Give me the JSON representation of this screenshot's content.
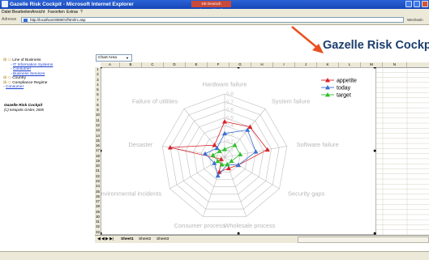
{
  "window": {
    "title": "Gazelle Risk Cockpit - Microsoft Internet Explorer",
    "language_indicator": "DE Deutsch (Deutschland)"
  },
  "menu": [
    "Datei",
    "Bearbeiten",
    "Ansicht",
    "Favoriten",
    "Extras",
    "?"
  ],
  "address": {
    "label": "Adresse",
    "url": "http://localhost:8080/rcfhtml/rc.asp",
    "go_label": "Wechseln"
  },
  "banner": {
    "title": "Gazelle Risk Cockpit"
  },
  "tree": [
    {
      "label": "Line of Business",
      "level": 0,
      "link": false,
      "icon": "folder-open-icon"
    },
    {
      "label": "IT Information Systems",
      "level": 1,
      "link": true,
      "icon": "page-icon"
    },
    {
      "label": "Consumer",
      "level": 1,
      "link": true,
      "icon": "page-icon"
    },
    {
      "label": "Business Services",
      "level": 1,
      "link": true,
      "icon": "page-icon"
    },
    {
      "label": "Country",
      "level": 0,
      "link": false,
      "icon": "folder-icon"
    },
    {
      "label": "Compliance Regime",
      "level": 0,
      "link": false,
      "icon": "folder-icon"
    },
    {
      "label": "Consumer",
      "level": 0,
      "link": true,
      "icon": "page-icon"
    }
  ],
  "logo": {
    "line1": "Gazelle Risk Cockpit",
    "line2": "(C) Intrapolis GmbH, 2005"
  },
  "spreadsheet": {
    "name_box": "Chart Area",
    "columns": [
      "A",
      "B",
      "C",
      "D",
      "E",
      "F",
      "G",
      "H",
      "I",
      "J",
      "K",
      "L",
      "M",
      "N"
    ],
    "rows": [
      "1",
      "2",
      "3",
      "4",
      "5",
      "6",
      "7",
      "8",
      "9",
      "10",
      "11",
      "12",
      "13",
      "14",
      "15",
      "16",
      "17",
      "18",
      "19",
      "20",
      "21",
      "22",
      "23",
      "24",
      "25",
      "26",
      "27",
      "28",
      "29",
      "30",
      "31",
      "32",
      "33"
    ],
    "tabs": [
      "Sheet1",
      "Sheet2",
      "Sheet3"
    ],
    "active_tab": "Sheet1"
  },
  "chart_data": {
    "type": "radar",
    "categories": [
      "Hardware failure",
      "System failure",
      "Software failure",
      "Security gaps",
      "Wholesale process",
      "Consumer process",
      "Environmental incidents",
      "Desaster",
      "Failure of utilities"
    ],
    "axis_ticks": [
      "0",
      "0.1",
      "0.2",
      "0.3",
      "0.4",
      "0.5",
      "0.6",
      "0.7",
      "0.8"
    ],
    "rmax": 0.8,
    "legend_position": "top-right",
    "series": [
      {
        "name": "appetite",
        "color": "#d8202a",
        "values": [
          0.45,
          0.5,
          0.55,
          0.2,
          0.15,
          0.2,
          0.05,
          0.7,
          0.2
        ]
      },
      {
        "name": "today",
        "color": "#3c6ed0",
        "values": [
          0.3,
          0.45,
          0.4,
          0.2,
          0.1,
          0.25,
          0.15,
          0.25,
          0.15
        ]
      },
      {
        "name": "target",
        "color": "#2fbf2f",
        "values": [
          0.1,
          0.2,
          0.2,
          0.1,
          0.1,
          0.1,
          0.1,
          0.15,
          0.1
        ]
      }
    ]
  },
  "colors": {
    "titlebar": "#1f56c6",
    "banner_title": "#1b3d6d",
    "arrow": "#e8501e"
  }
}
